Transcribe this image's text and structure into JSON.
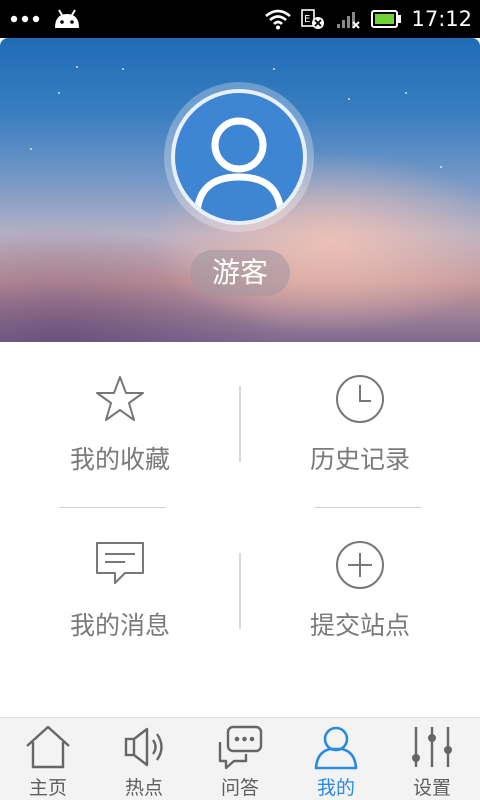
{
  "status_bar": {
    "time": "17:12"
  },
  "profile": {
    "username": "游客"
  },
  "menu": [
    {
      "label": "我的收藏",
      "icon": "star-outline-icon"
    },
    {
      "label": "历史记录",
      "icon": "clock-icon"
    },
    {
      "label": "我的消息",
      "icon": "message-icon"
    },
    {
      "label": "提交站点",
      "icon": "add-circle-icon"
    }
  ],
  "tabs": [
    {
      "label": "主页",
      "icon": "home-icon",
      "active": false
    },
    {
      "label": "热点",
      "icon": "speaker-icon",
      "active": false
    },
    {
      "label": "问答",
      "icon": "chat-bubbles-icon",
      "active": false
    },
    {
      "label": "我的",
      "icon": "person-icon",
      "active": true
    },
    {
      "label": "设置",
      "icon": "sliders-icon",
      "active": false
    }
  ],
  "colors": {
    "accent": "#2a8ae0",
    "avatar_bg": "#3e85d3",
    "tab_inactive": "#5f5f5f",
    "menu_text": "#7a7a7a"
  }
}
